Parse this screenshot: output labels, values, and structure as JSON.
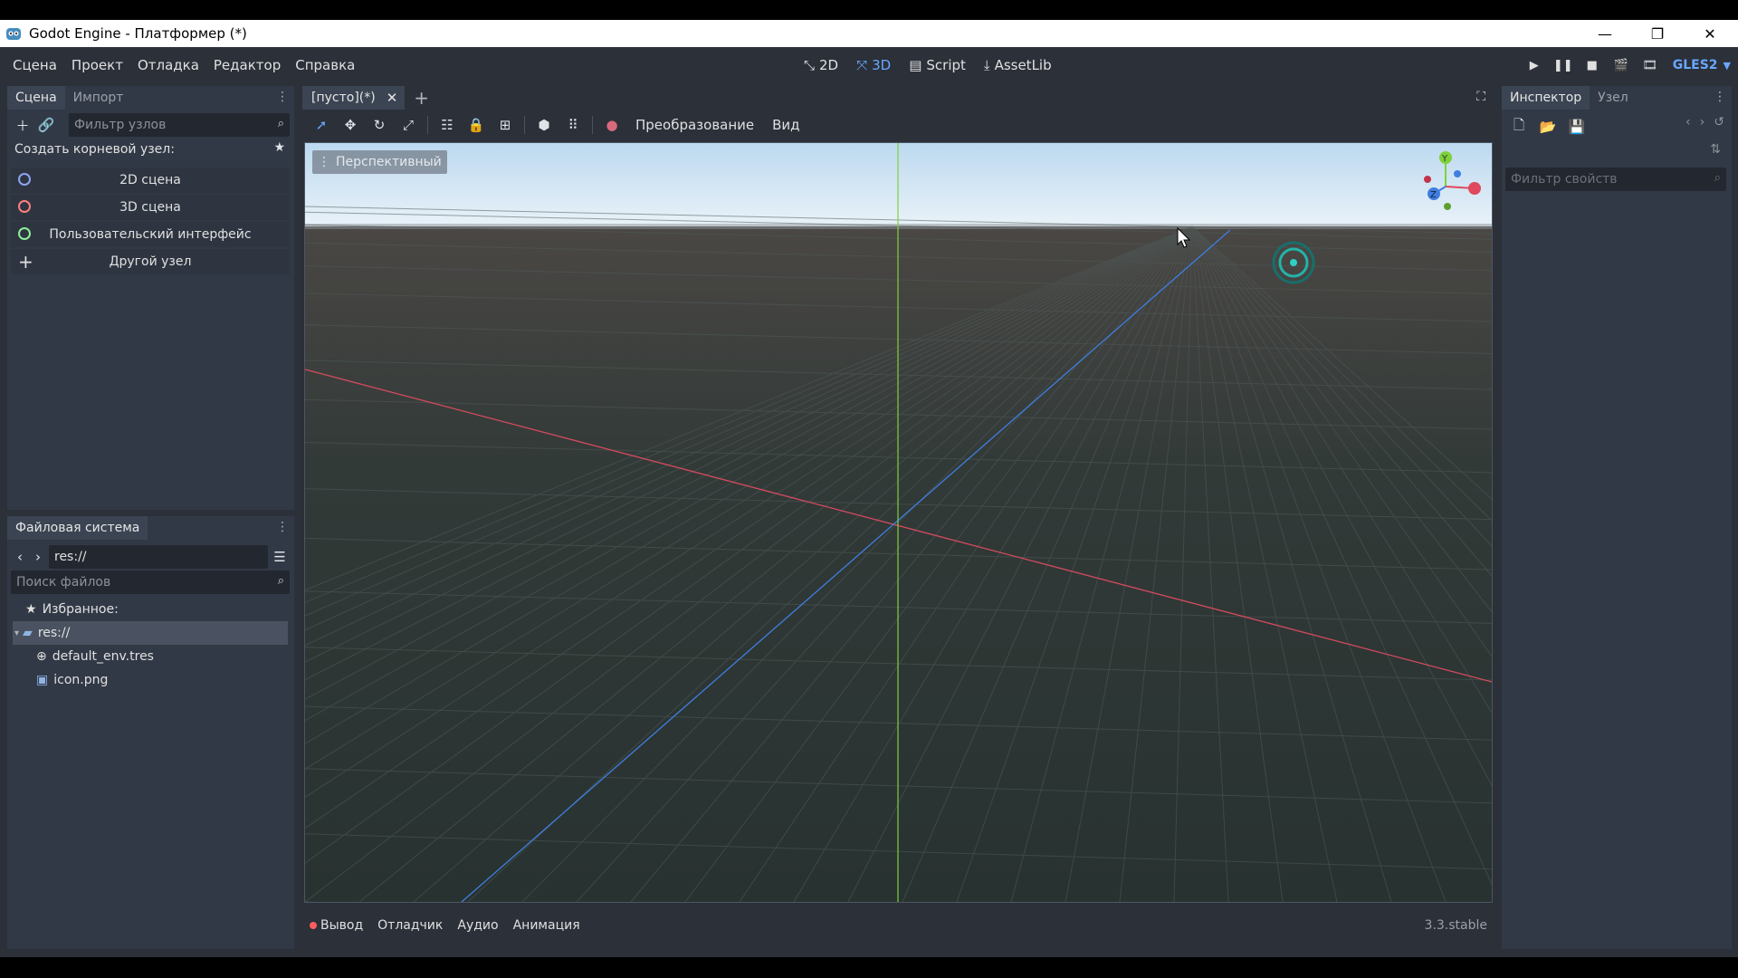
{
  "window": {
    "title": "Godot Engine - Платформер (*)",
    "minimize": "—",
    "maximize": "❐",
    "close": "✕"
  },
  "menu": [
    "Сцена",
    "Проект",
    "Отладка",
    "Редактор",
    "Справка"
  ],
  "workspaces": [
    {
      "label": "2D",
      "icon": "2d-icon"
    },
    {
      "label": "3D",
      "icon": "3d-icon",
      "active": true
    },
    {
      "label": "Script",
      "icon": "script-icon"
    },
    {
      "label": "AssetLib",
      "icon": "assetlib-icon"
    }
  ],
  "renderer": "GLES2",
  "scene_dock": {
    "tabs": [
      "Сцена",
      "Импорт"
    ],
    "filter_placeholder": "Фильтр узлов",
    "create_root_label": "Создать корневой узел:",
    "root_nodes": [
      {
        "label": "2D сцена",
        "color": "#8da5f3"
      },
      {
        "label": "3D сцена",
        "color": "#fc7f7f"
      },
      {
        "label": "Пользовательский интерфейс",
        "color": "#8eef97"
      },
      {
        "label": "Другой узел",
        "color": "#e0e0e0"
      }
    ]
  },
  "filesystem": {
    "title": "Файловая система",
    "path": "res://",
    "search_placeholder": "Поиск файлов",
    "favorites": "Избранное:",
    "root": "res://",
    "files": [
      "default_env.tres",
      "icon.png"
    ]
  },
  "editor_tabs": {
    "scene_tab": "[пусто](*)"
  },
  "viewport_menu": {
    "transform": "Преобразование",
    "view": "Вид",
    "perspective": "Перспективный"
  },
  "bottom": {
    "tabs": [
      "Вывод",
      "Отладчик",
      "Аудио",
      "Анимация"
    ],
    "version": "3.3.stable"
  },
  "inspector": {
    "tabs": [
      "Инспектор",
      "Узел"
    ],
    "filter_placeholder": "Фильтр свойств"
  },
  "colors": {
    "accent": "#6aa7ff",
    "x_axis": "#d64a5f",
    "y_axis": "#7fd13b",
    "z_axis": "#3f7ee0"
  }
}
